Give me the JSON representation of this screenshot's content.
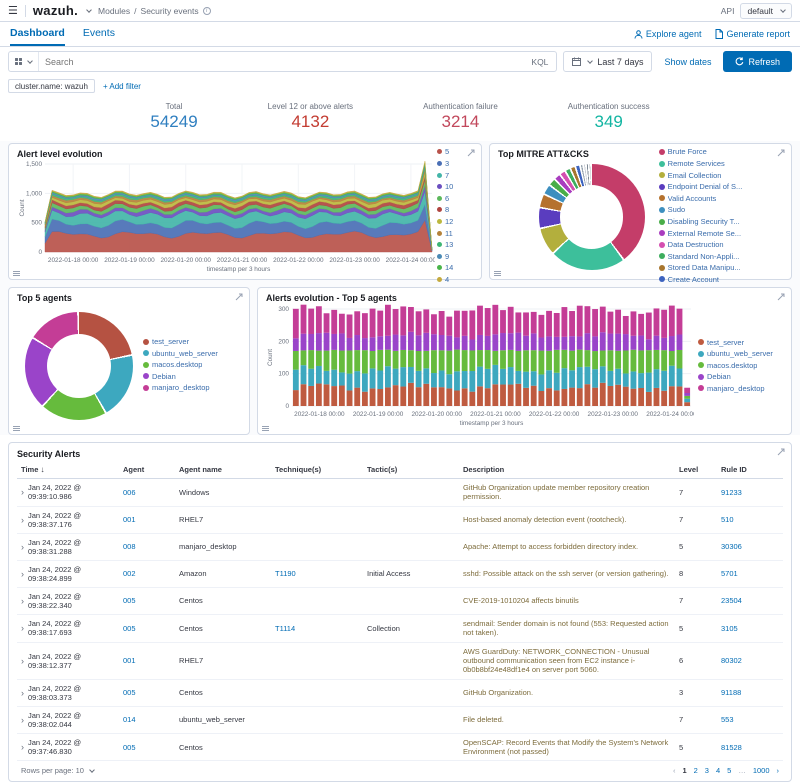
{
  "icons": {
    "menu": "☰",
    "ellipsis": "…",
    "prev": "‹",
    "next": "›",
    "sort_desc": "↓",
    "row_chevron": "›"
  },
  "header": {
    "logo": "wazuh.",
    "breadcrumb": [
      "Modules",
      "Security events"
    ],
    "api_label": "API",
    "api_value": "default"
  },
  "tabs": {
    "items": [
      "Dashboard",
      "Events"
    ],
    "active": "Dashboard",
    "explore_agent": "Explore agent",
    "generate_report": "Generate report"
  },
  "search": {
    "placeholder": "Search",
    "kql": "KQL",
    "time_range": "Last 7 days",
    "show_dates": "Show dates",
    "refresh": "Refresh"
  },
  "filters": {
    "chip": "cluster.name: wazuh",
    "add": "+ Add filter"
  },
  "stats": [
    {
      "label": "Total",
      "value": "54249",
      "color": "#2f7fc0"
    },
    {
      "label": "Level 12 or above alerts",
      "value": "4132",
      "color": "#c33c32"
    },
    {
      "label": "Authentication failure",
      "value": "3214",
      "color": "#c2485c"
    },
    {
      "label": "Authentication success",
      "value": "349",
      "color": "#12b5a2"
    }
  ],
  "chart_data": [
    {
      "type": "area",
      "title": "Alert level evolution",
      "xlabel": "timestamp per 3 hours",
      "ylabel": "Count",
      "ylim": [
        0,
        1500
      ],
      "y_tick_vals": [
        0,
        500,
        1000,
        1500
      ],
      "y_ticks": [
        "0",
        "500",
        "1,000",
        "1,500"
      ],
      "x_ticks": [
        "2022-01-18 00:00",
        "2022-01-19 00:00",
        "2022-01-20 00:00",
        "2022-01-21 00:00",
        "2022-01-22 00:00",
        "2022-01-23 00:00",
        "2022-01-24 00:00"
      ],
      "points": 56,
      "grid": true,
      "legend_position": "right",
      "series": [
        {
          "name": "5",
          "color": "#b8524a",
          "base": 300
        },
        {
          "name": "3",
          "color": "#4a6fb5",
          "base": 180
        },
        {
          "name": "7",
          "color": "#43b5a8",
          "base": 160
        },
        {
          "name": "10",
          "color": "#6b4fc0",
          "base": 60
        },
        {
          "name": "6",
          "color": "#5cb85c",
          "base": 65
        },
        {
          "name": "8",
          "color": "#b04540",
          "base": 55
        },
        {
          "name": "12",
          "color": "#bcb83e",
          "base": 50
        },
        {
          "name": "11",
          "color": "#b5823a",
          "base": 35
        },
        {
          "name": "13",
          "color": "#3eb574",
          "base": 25
        },
        {
          "name": "9",
          "color": "#4a8ab5",
          "base": 25
        },
        {
          "name": "14",
          "color": "#4ab54a",
          "base": 20
        },
        {
          "name": "4",
          "color": "#c4aa3e",
          "base": 15
        }
      ]
    },
    {
      "type": "pie",
      "title": "Top MITRE ATT&CKS",
      "legend_position": "right",
      "slices": [
        {
          "label": "Brute Force",
          "value": 38,
          "color": "#c43d69"
        },
        {
          "label": "Remote Services",
          "value": 22,
          "color": "#3dbf9b"
        },
        {
          "label": "Email Collection",
          "value": 8,
          "color": "#b3af3d"
        },
        {
          "label": "Endpoint Denial of S...",
          "value": 6,
          "color": "#5a3dbf"
        },
        {
          "label": "Valid Accounts",
          "value": 4,
          "color": "#b5722e"
        },
        {
          "label": "Sudo",
          "value": 3,
          "color": "#3d8fbf"
        },
        {
          "label": "Disabling Security T...",
          "value": 2.2,
          "color": "#49ad49"
        },
        {
          "label": "External Remote Se...",
          "value": 2,
          "color": "#a93dbf"
        },
        {
          "label": "Data Destruction",
          "value": 1.8,
          "color": "#d44fb0"
        },
        {
          "label": "Standard Non-Appli...",
          "value": 1.6,
          "color": "#3dad5e"
        },
        {
          "label": "Stored Data Manipu...",
          "value": 1.5,
          "color": "#a8762e"
        },
        {
          "label": "Create Account",
          "value": 1.4,
          "color": "#3d63bf"
        }
      ],
      "other_slivers": [
        {
          "value": 0.9,
          "color": "#9aa5b1"
        },
        {
          "value": 0.8,
          "color": "#c8cdd4"
        },
        {
          "value": 0.8,
          "color": "#7d8894"
        },
        {
          "value": 0.7,
          "color": "#b4bac2"
        }
      ]
    },
    {
      "type": "pie",
      "title": "Top 5 agents",
      "legend_position": "right",
      "slices": [
        {
          "label": "test_server",
          "value": 22,
          "color": "#b55242"
        },
        {
          "label": "ubuntu_web_server",
          "value": 20,
          "color": "#3da8bf"
        },
        {
          "label": "macos.desktop",
          "value": 20,
          "color": "#66bb3d"
        },
        {
          "label": "Debian",
          "value": 22,
          "color": "#9a44c9"
        },
        {
          "label": "manjaro_desktop",
          "value": 16,
          "color": "#c43d96"
        }
      ]
    },
    {
      "type": "bar",
      "title": "Alerts evolution - Top 5 agents",
      "stacked": true,
      "xlabel": "timestamp per 3 hours",
      "ylabel": "Count",
      "ylim": [
        0,
        300
      ],
      "y_tick_vals": [
        0,
        100,
        200,
        300
      ],
      "y_ticks": [
        "0",
        "100",
        "200",
        "300"
      ],
      "x_ticks": [
        "2022-01-18 00:00",
        "2022-01-19 00:00",
        "2022-01-20 00:00",
        "2022-01-21 00:00",
        "2022-01-22 00:00",
        "2022-01-23 00:00",
        "2022-01-24 00:00"
      ],
      "bars": 52,
      "legend_position": "right",
      "series": [
        {
          "name": "test_server",
          "color": "#bf5b40",
          "base": 60
        },
        {
          "name": "ubuntu_web_server",
          "color": "#3da8bf",
          "base": 55
        },
        {
          "name": "macos.desktop",
          "color": "#66bb3d",
          "base": 62
        },
        {
          "name": "Debian",
          "color": "#9a44c9",
          "base": 48
        },
        {
          "name": "manjaro_desktop",
          "color": "#c43d96",
          "base": 80
        }
      ]
    }
  ],
  "table": {
    "title": "Security Alerts",
    "columns": [
      "Time",
      "Agent",
      "Agent name",
      "Technique(s)",
      "Tactic(s)",
      "Description",
      "Level",
      "Rule ID"
    ],
    "rows": [
      {
        "time": "Jan 24, 2022 @ 09:39:10.986",
        "agent": "006",
        "agent_name": "Windows",
        "technique": "",
        "tactic": "",
        "description": "GitHub Organization update member repository creation permission.",
        "level": "7",
        "rule_id": "91233"
      },
      {
        "time": "Jan 24, 2022 @ 09:38:37.176",
        "agent": "001",
        "agent_name": "RHEL7",
        "technique": "",
        "tactic": "",
        "description": "Host-based anomaly detection event (rootcheck).",
        "level": "7",
        "rule_id": "510"
      },
      {
        "time": "Jan 24, 2022 @ 09:38:31.288",
        "agent": "008",
        "agent_name": "manjaro_desktop",
        "technique": "",
        "tactic": "",
        "description": "Apache: Attempt to access forbidden directory index.",
        "level": "5",
        "rule_id": "30306"
      },
      {
        "time": "Jan 24, 2022 @ 09:38:24.899",
        "agent": "002",
        "agent_name": "Amazon",
        "technique": "T1190",
        "tactic": "Initial Access",
        "description": "sshd: Possible attack on the ssh server (or version gathering).",
        "level": "8",
        "rule_id": "5701"
      },
      {
        "time": "Jan 24, 2022 @ 09:38:22.340",
        "agent": "005",
        "agent_name": "Centos",
        "technique": "",
        "tactic": "",
        "description": "CVE-2019-1010204 affects binutils",
        "level": "7",
        "rule_id": "23504"
      },
      {
        "time": "Jan 24, 2022 @ 09:38:17.693",
        "agent": "005",
        "agent_name": "Centos",
        "technique": "T1114",
        "tactic": "Collection",
        "description": "sendmail: Sender domain is not found (553: Requested action not taken).",
        "level": "5",
        "rule_id": "3105"
      },
      {
        "time": "Jan 24, 2022 @ 09:38:12.377",
        "agent": "001",
        "agent_name": "RHEL7",
        "technique": "",
        "tactic": "",
        "description": "AWS GuardDuty: NETWORK_CONNECTION - Unusual outbound communication seen from EC2 instance i-0b0b8bf24e48df1e4 on server port 5060.",
        "level": "6",
        "rule_id": "80302"
      },
      {
        "time": "Jan 24, 2022 @ 09:38:03.373",
        "agent": "005",
        "agent_name": "Centos",
        "technique": "",
        "tactic": "",
        "description": "GitHub Organization.",
        "level": "3",
        "rule_id": "91188"
      },
      {
        "time": "Jan 24, 2022 @ 09:38:02.044",
        "agent": "014",
        "agent_name": "ubuntu_web_server",
        "technique": "",
        "tactic": "",
        "description": "File deleted.",
        "level": "7",
        "rule_id": "553"
      },
      {
        "time": "Jan 24, 2022 @ 09:37:46.830",
        "agent": "005",
        "agent_name": "Centos",
        "technique": "",
        "tactic": "",
        "description": "OpenSCAP: Record Events that Modify the System's Network Environment (not passed)",
        "level": "5",
        "rule_id": "81528"
      }
    ]
  },
  "footer": {
    "rows_per_page": "Rows per page: 10",
    "pages": [
      "1",
      "2",
      "3",
      "4",
      "5",
      "…",
      "1000"
    ],
    "active_page": "1"
  }
}
